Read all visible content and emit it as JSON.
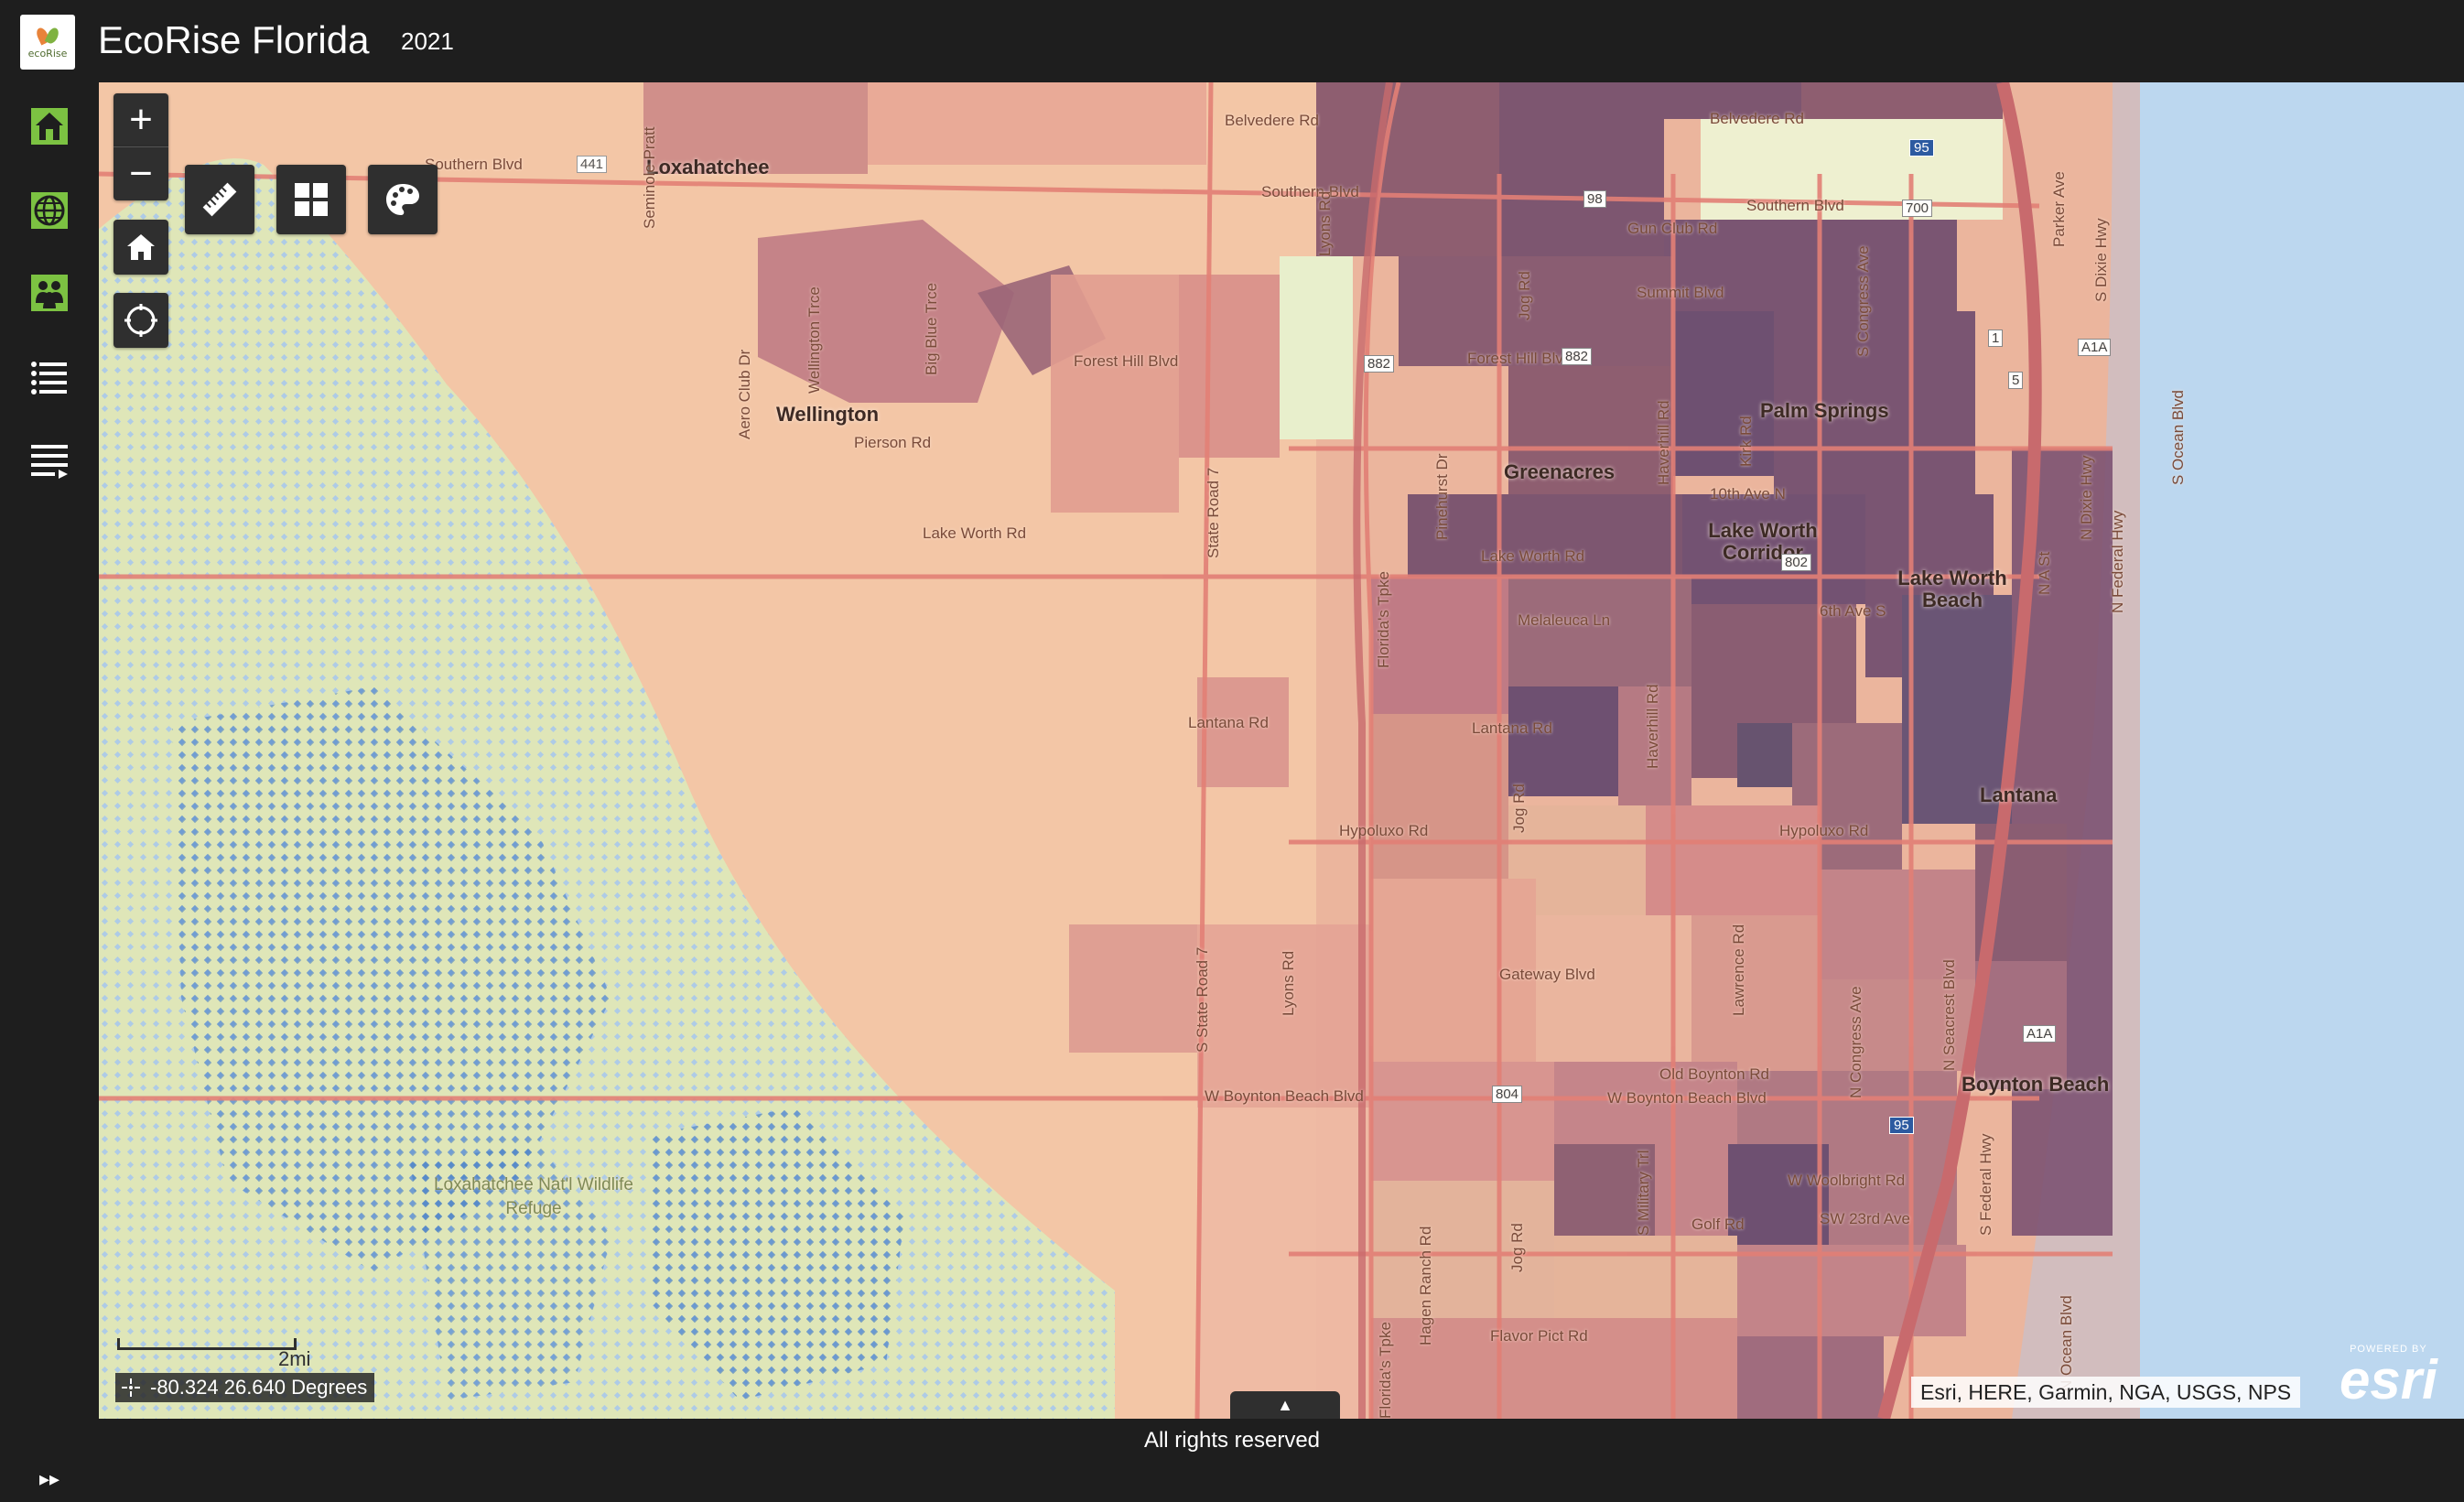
{
  "header": {
    "logo_text": "ecoRise",
    "title": "EcoRise Florida",
    "year": "2021"
  },
  "sidebar": {
    "items": [
      {
        "name": "home-icon",
        "label": "Home"
      },
      {
        "name": "globe-icon",
        "label": "Map"
      },
      {
        "name": "people-icon",
        "label": "Community"
      },
      {
        "name": "list-icon",
        "label": "Layers"
      },
      {
        "name": "menu-icon",
        "label": "Menu"
      }
    ],
    "expand_glyph": "▸▸"
  },
  "map": {
    "controls": {
      "zoom_in": "+",
      "zoom_out": "−"
    },
    "labels": {
      "loxahatchee": "Loxahatchee",
      "wellington": "Wellington",
      "palm_springs": "Palm Springs",
      "greenacres": "Greenacres",
      "lake_worth_corridor": "Lake Worth Corridor",
      "lake_worth_beach": "Lake Worth Beach",
      "lantana": "Lantana",
      "boynton_beach": "Boynton Beach",
      "refuge": "Loxahatchee Nat'l Wildlife Refuge",
      "southern_blvd": "Southern Blvd",
      "southern_blvd_2": "Southern Blvd",
      "southern_blvd_3": "Southern Blvd",
      "belvedere_rd": "Belvedere Rd",
      "belvedere_rd_2": "Belvedere Rd",
      "gun_club_rd": "Gun Club Rd",
      "summit_blvd": "Summit Blvd",
      "forest_hill_blvd": "Forest Hill Blvd",
      "forest_hill_blvd_2": "Forest Hill Blvd",
      "pierson_rd": "Pierson Rd",
      "lake_worth_rd": "Lake Worth Rd",
      "lake_worth_rd_2": "Lake Worth Rd",
      "tenth_ave": "10th Ave N",
      "sixth_ave": "6th Ave S",
      "melaleuca_ln": "Melaleuca Ln",
      "lantana_rd": "Lantana Rd",
      "lantana_rd_2": "Lantana Rd",
      "hypoluxo_rd": "Hypoluxo Rd",
      "hypoluxo_rd_2": "Hypoluxo Rd",
      "gateway_blvd": "Gateway Blvd",
      "old_boynton_rd": "Old Boynton Rd",
      "w_boynton_beach_blvd": "W Boynton Beach Blvd",
      "w_boynton_beach_blvd_2": "W Boynton Beach Blvd",
      "w_woolbright_rd": "W Woolbright Rd",
      "golf_rd": "Golf Rd",
      "sw_23rd_ave": "SW 23rd Ave",
      "flavor_pict_rd": "Flavor Pict Rd",
      "state_road_7": "State Road 7",
      "s_state_road_7": "S State Road 7",
      "lyons_rd": "Lyons Rd",
      "lyons_rd_2": "Lyons Rd",
      "jog_rd": "Jog Rd",
      "jog_rd_2": "Jog Rd",
      "jog_rd_3": "Jog Rd",
      "haverhill_rd": "Haverhill Rd",
      "haverhill_rd_2": "Haverhill Rd",
      "kirk_rd": "Kirk Rd",
      "congress_ave": "S Congress Ave",
      "n_congress_ave": "N Congress Ave",
      "military_trl": "S Military Trl",
      "lawrence_rd": "Lawrence Rd",
      "hagen_ranch_rd": "Hagen Ranch Rd",
      "floridas_tpke": "Florida's Tpke",
      "floridas_tpke_2": "Florida's Tpke",
      "aero_club_dr": "Aero Club Dr",
      "wellington_trce": "Wellington Trce",
      "big_blue_trce": "Big Blue Trce",
      "pinehurst_dr": "Pinehurst Dr",
      "n_dixie_hwy": "N Dixie Hwy",
      "s_dixie_hwy": "S Dixie Hwy",
      "n_federal_hwy": "N Federal Hwy",
      "s_federal_hwy": "S Federal Hwy",
      "ocean_blvd": "S Ocean Blvd",
      "n_ocean_blvd": "N Ocean Blvd",
      "parker_ave": "Parker Ave",
      "n_a_st": "N A St",
      "n_seacrest_blvd": "N Seacrest Blvd",
      "seminole_pratt": "Seminole Pratt",
      "rte_441": "441",
      "rte_882": "882",
      "rte_882b": "882",
      "rte_802": "802",
      "rte_804": "804",
      "rte_98": "98",
      "rte_700": "700",
      "rte_1": "1",
      "rte_5": "5",
      "rte_a1a": "A1A",
      "rte_a1a_2": "A1A",
      "rte_95": "95",
      "rte_95_2": "95"
    },
    "scale_label": "2mi",
    "coordinates": "-80.324 26.640 Degrees",
    "attribution": "Esri, HERE, Garmin, NGA, USGS, NPS",
    "esri_powered": "POWERED BY",
    "esri_name": "esri",
    "panel_toggle": "▲"
  },
  "footer": {
    "text": "All rights reserved"
  },
  "colors": {
    "header_bg": "#1e1e1e",
    "icon_green": "#7cc242",
    "water": "#bcd7ef",
    "wetland": "#dfe6b8",
    "urban_light": "#f3c6a6",
    "choropleth_mid": "#d98a87",
    "choropleth_dark": "#8a5a6e",
    "choropleth_darkest": "#6c5070"
  }
}
